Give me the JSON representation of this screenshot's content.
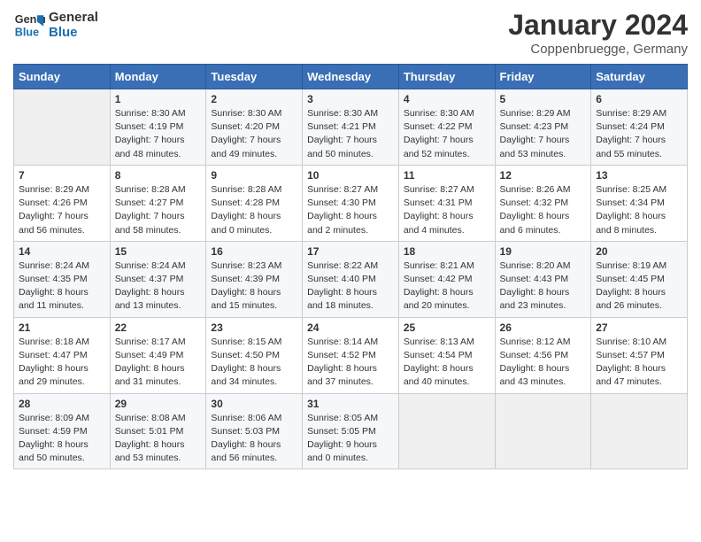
{
  "header": {
    "logo_line1": "General",
    "logo_line2": "Blue",
    "title": "January 2024",
    "subtitle": "Coppenbruegge, Germany"
  },
  "calendar": {
    "days_of_week": [
      "Sunday",
      "Monday",
      "Tuesday",
      "Wednesday",
      "Thursday",
      "Friday",
      "Saturday"
    ],
    "weeks": [
      [
        {
          "day": "",
          "info": ""
        },
        {
          "day": "1",
          "info": "Sunrise: 8:30 AM\nSunset: 4:19 PM\nDaylight: 7 hours\nand 48 minutes."
        },
        {
          "day": "2",
          "info": "Sunrise: 8:30 AM\nSunset: 4:20 PM\nDaylight: 7 hours\nand 49 minutes."
        },
        {
          "day": "3",
          "info": "Sunrise: 8:30 AM\nSunset: 4:21 PM\nDaylight: 7 hours\nand 50 minutes."
        },
        {
          "day": "4",
          "info": "Sunrise: 8:30 AM\nSunset: 4:22 PM\nDaylight: 7 hours\nand 52 minutes."
        },
        {
          "day": "5",
          "info": "Sunrise: 8:29 AM\nSunset: 4:23 PM\nDaylight: 7 hours\nand 53 minutes."
        },
        {
          "day": "6",
          "info": "Sunrise: 8:29 AM\nSunset: 4:24 PM\nDaylight: 7 hours\nand 55 minutes."
        }
      ],
      [
        {
          "day": "7",
          "info": "Sunrise: 8:29 AM\nSunset: 4:26 PM\nDaylight: 7 hours\nand 56 minutes."
        },
        {
          "day": "8",
          "info": "Sunrise: 8:28 AM\nSunset: 4:27 PM\nDaylight: 7 hours\nand 58 minutes."
        },
        {
          "day": "9",
          "info": "Sunrise: 8:28 AM\nSunset: 4:28 PM\nDaylight: 8 hours\nand 0 minutes."
        },
        {
          "day": "10",
          "info": "Sunrise: 8:27 AM\nSunset: 4:30 PM\nDaylight: 8 hours\nand 2 minutes."
        },
        {
          "day": "11",
          "info": "Sunrise: 8:27 AM\nSunset: 4:31 PM\nDaylight: 8 hours\nand 4 minutes."
        },
        {
          "day": "12",
          "info": "Sunrise: 8:26 AM\nSunset: 4:32 PM\nDaylight: 8 hours\nand 6 minutes."
        },
        {
          "day": "13",
          "info": "Sunrise: 8:25 AM\nSunset: 4:34 PM\nDaylight: 8 hours\nand 8 minutes."
        }
      ],
      [
        {
          "day": "14",
          "info": "Sunrise: 8:24 AM\nSunset: 4:35 PM\nDaylight: 8 hours\nand 11 minutes."
        },
        {
          "day": "15",
          "info": "Sunrise: 8:24 AM\nSunset: 4:37 PM\nDaylight: 8 hours\nand 13 minutes."
        },
        {
          "day": "16",
          "info": "Sunrise: 8:23 AM\nSunset: 4:39 PM\nDaylight: 8 hours\nand 15 minutes."
        },
        {
          "day": "17",
          "info": "Sunrise: 8:22 AM\nSunset: 4:40 PM\nDaylight: 8 hours\nand 18 minutes."
        },
        {
          "day": "18",
          "info": "Sunrise: 8:21 AM\nSunset: 4:42 PM\nDaylight: 8 hours\nand 20 minutes."
        },
        {
          "day": "19",
          "info": "Sunrise: 8:20 AM\nSunset: 4:43 PM\nDaylight: 8 hours\nand 23 minutes."
        },
        {
          "day": "20",
          "info": "Sunrise: 8:19 AM\nSunset: 4:45 PM\nDaylight: 8 hours\nand 26 minutes."
        }
      ],
      [
        {
          "day": "21",
          "info": "Sunrise: 8:18 AM\nSunset: 4:47 PM\nDaylight: 8 hours\nand 29 minutes."
        },
        {
          "day": "22",
          "info": "Sunrise: 8:17 AM\nSunset: 4:49 PM\nDaylight: 8 hours\nand 31 minutes."
        },
        {
          "day": "23",
          "info": "Sunrise: 8:15 AM\nSunset: 4:50 PM\nDaylight: 8 hours\nand 34 minutes."
        },
        {
          "day": "24",
          "info": "Sunrise: 8:14 AM\nSunset: 4:52 PM\nDaylight: 8 hours\nand 37 minutes."
        },
        {
          "day": "25",
          "info": "Sunrise: 8:13 AM\nSunset: 4:54 PM\nDaylight: 8 hours\nand 40 minutes."
        },
        {
          "day": "26",
          "info": "Sunrise: 8:12 AM\nSunset: 4:56 PM\nDaylight: 8 hours\nand 43 minutes."
        },
        {
          "day": "27",
          "info": "Sunrise: 8:10 AM\nSunset: 4:57 PM\nDaylight: 8 hours\nand 47 minutes."
        }
      ],
      [
        {
          "day": "28",
          "info": "Sunrise: 8:09 AM\nSunset: 4:59 PM\nDaylight: 8 hours\nand 50 minutes."
        },
        {
          "day": "29",
          "info": "Sunrise: 8:08 AM\nSunset: 5:01 PM\nDaylight: 8 hours\nand 53 minutes."
        },
        {
          "day": "30",
          "info": "Sunrise: 8:06 AM\nSunset: 5:03 PM\nDaylight: 8 hours\nand 56 minutes."
        },
        {
          "day": "31",
          "info": "Sunrise: 8:05 AM\nSunset: 5:05 PM\nDaylight: 9 hours\nand 0 minutes."
        },
        {
          "day": "",
          "info": ""
        },
        {
          "day": "",
          "info": ""
        },
        {
          "day": "",
          "info": ""
        }
      ]
    ]
  }
}
